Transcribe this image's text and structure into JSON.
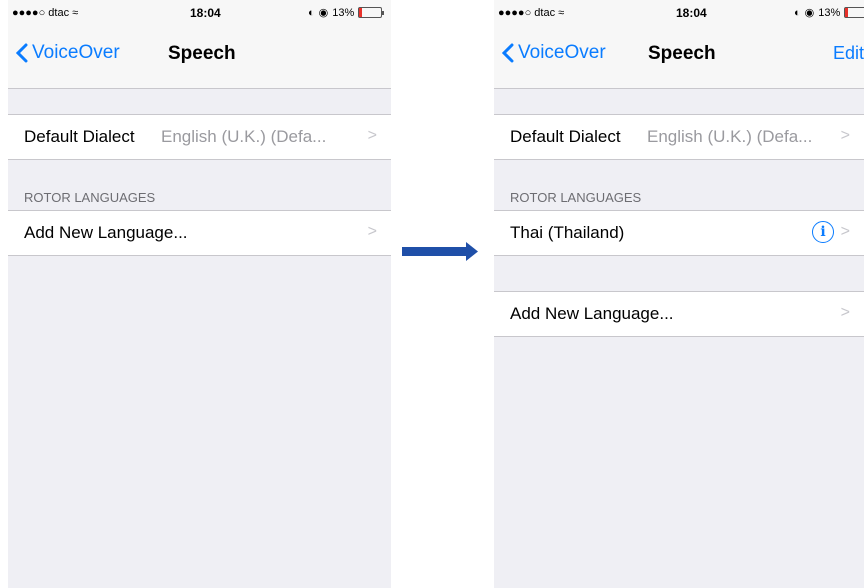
{
  "left": {
    "status": {
      "carrier": "●●●●○ dtac",
      "time": "18:04",
      "battery": "13%"
    },
    "nav": {
      "back": "VoiceOver",
      "title": "Speech"
    },
    "default_dialect": {
      "label": "Default Dialect",
      "value": "English (U.K.) (Defa..."
    },
    "rotor_header": "ROTOR LANGUAGES",
    "add_language": "Add New Language..."
  },
  "right": {
    "status": {
      "carrier": "●●●●○ dtac",
      "time": "18:04",
      "battery": "13%"
    },
    "nav": {
      "back": "VoiceOver",
      "title": "Speech",
      "edit": "Edit"
    },
    "default_dialect": {
      "label": "Default Dialect",
      "value": "English (U.K.) (Defa..."
    },
    "rotor_header": "ROTOR LANGUAGES",
    "languages": [
      {
        "label": "Thai (Thailand)"
      }
    ],
    "add_language": "Add New Language..."
  },
  "colors": {
    "accent": "#0a7cff",
    "arrow": "#1f4fa8",
    "background": "#efeff4"
  },
  "icons": [
    "wifi-icon",
    "alarm-icon",
    "battery-icon",
    "info-icon",
    "chevron-right-icon",
    "back-chevron-icon",
    "arrow-right-icon"
  ]
}
